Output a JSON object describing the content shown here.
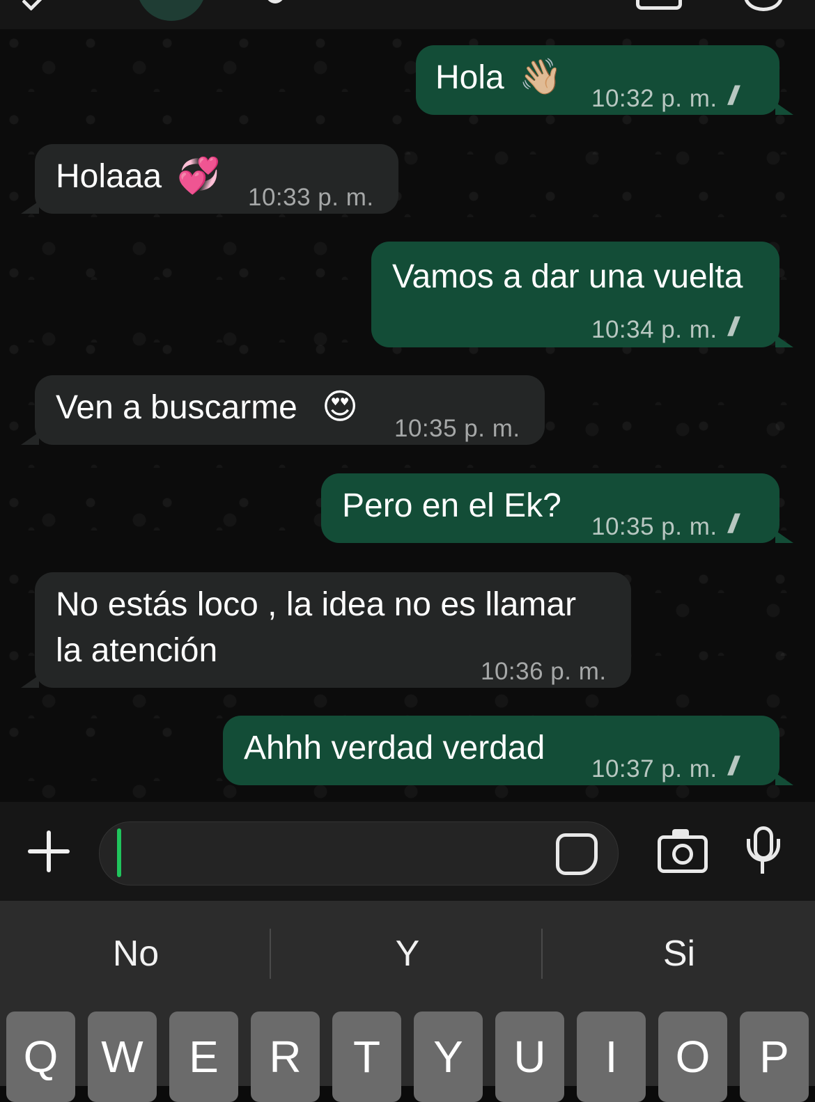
{
  "messages": [
    {
      "direction": "out",
      "text": "Hola",
      "emoji": "👋🏼",
      "time": "10:32 p. m.",
      "ticks": "//"
    },
    {
      "direction": "in",
      "text": "Holaaa",
      "emoji": "💞",
      "time": "10:33 p. m."
    },
    {
      "direction": "out",
      "text": "Vamos a dar una vuelta",
      "time": "10:34 p. m.",
      "ticks": "//"
    },
    {
      "direction": "in",
      "text": "Ven a buscarme",
      "emoji": "😍",
      "time": "10:35 p. m."
    },
    {
      "direction": "out",
      "text": "Pero en el Ek?",
      "time": "10:35 p. m.",
      "ticks": "//"
    },
    {
      "direction": "in",
      "line1": "No estás loco , la idea no es llamar",
      "line2": "la atención",
      "time": "10:36 p. m."
    },
    {
      "direction": "out",
      "text": "Ahhh verdad verdad",
      "time": "10:37 p. m.",
      "ticks": "//"
    }
  ],
  "suggestions": [
    "No",
    "Y",
    "Si"
  ],
  "keys": [
    "Q",
    "W",
    "E",
    "R",
    "T",
    "Y",
    "U",
    "I",
    "O",
    "P"
  ],
  "icons": {
    "back": "chevron-left-icon",
    "video": "video-call-icon",
    "phone": "phone-icon",
    "attach": "plus-icon",
    "sticker": "sticker-icon",
    "camera": "camera-icon",
    "mic": "microphone-icon"
  },
  "colors": {
    "outgoing_bubble": "#134d37",
    "incoming_bubble": "#242626",
    "caret": "#20c45c"
  }
}
